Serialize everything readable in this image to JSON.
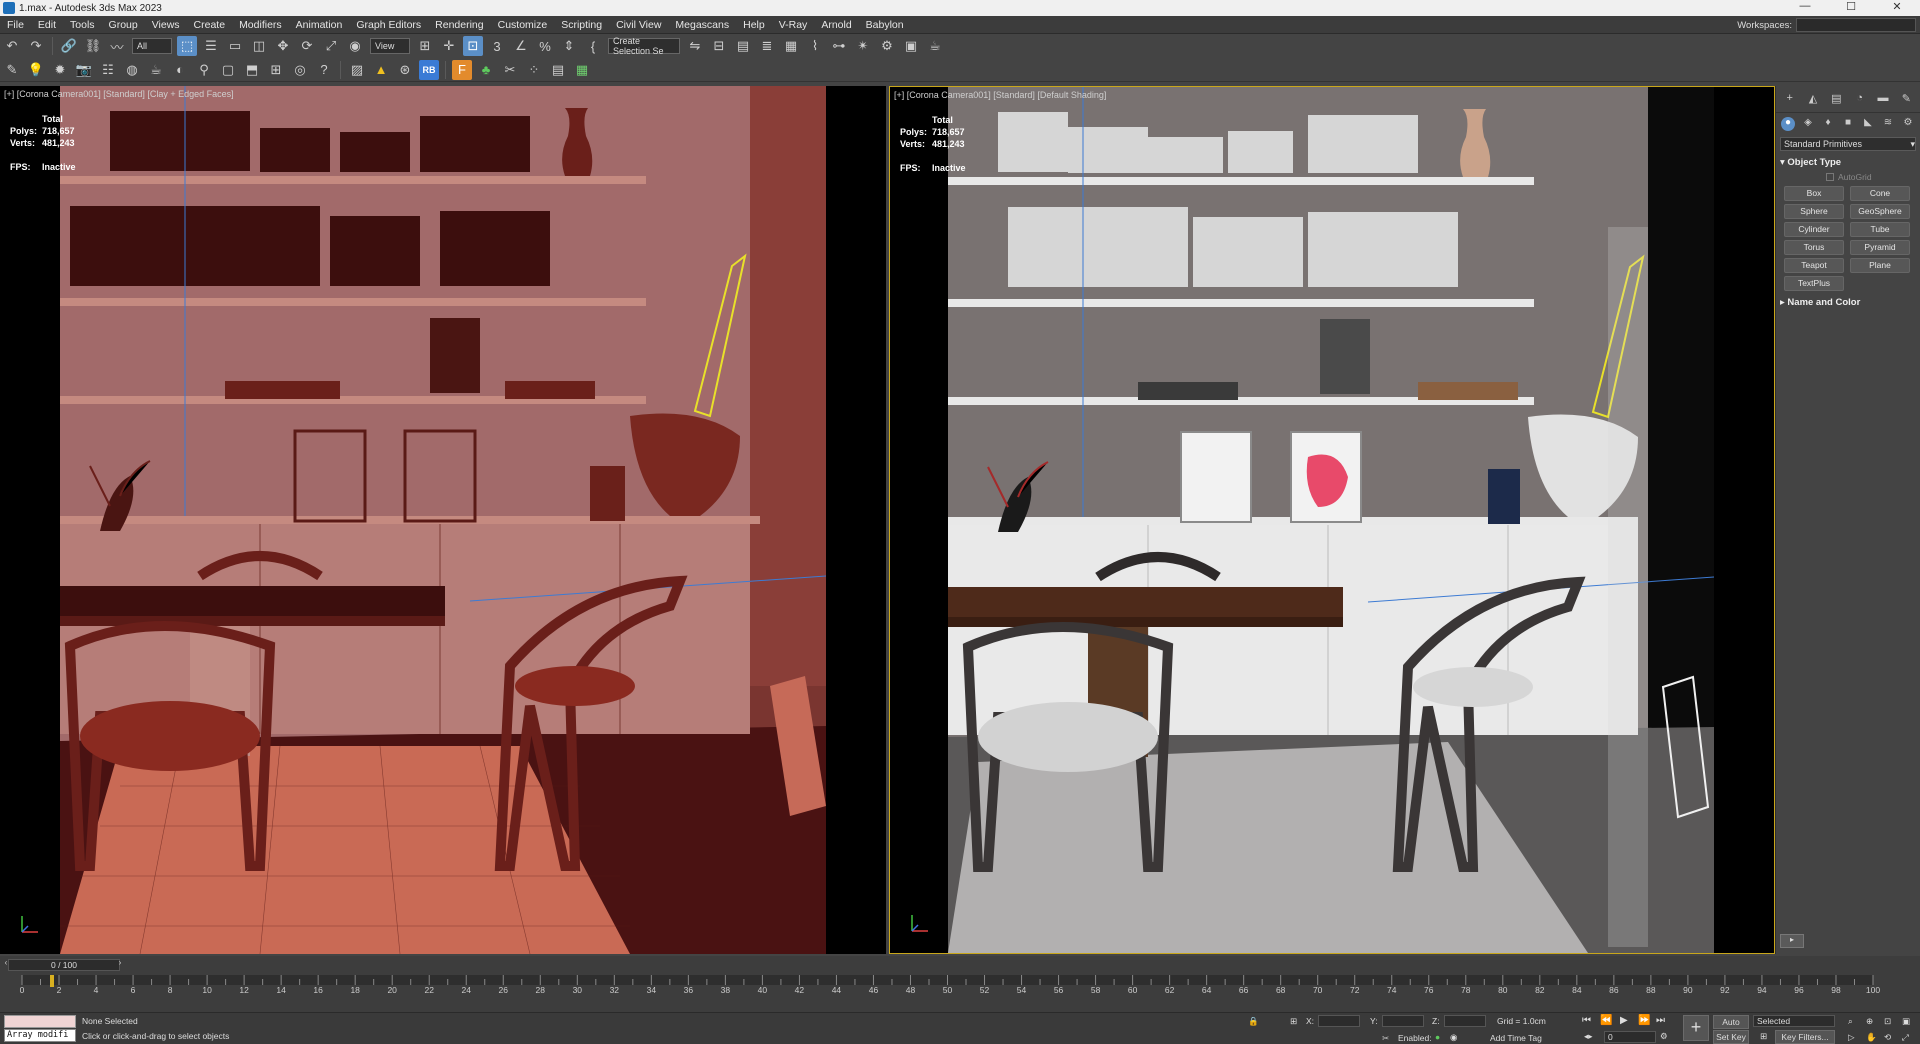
{
  "window": {
    "title": "1.max - Autodesk 3ds Max 2023",
    "minimize": "—",
    "maximize": "☐",
    "close": "✕"
  },
  "menu": [
    "File",
    "Edit",
    "Tools",
    "Group",
    "Views",
    "Create",
    "Modifiers",
    "Animation",
    "Graph Editors",
    "Rendering",
    "Customize",
    "Scripting",
    "Civil View",
    "Megascans",
    "Help",
    "V-Ray",
    "Arnold",
    "Babylon"
  ],
  "workspaces_label": "Workspaces:",
  "toolbar": {
    "selection_filter": "All",
    "ref_coord": "View",
    "named_selection": "Create Selection Se"
  },
  "viewport_left": {
    "label": "[+] [Corona Camera001] [Standard] [Clay + Edged Faces]",
    "stats": {
      "total": "Total",
      "polys_label": "Polys:",
      "polys": "718,657",
      "verts_label": "Verts:",
      "verts": "481,243",
      "fps_label": "FPS:",
      "fps": "Inactive"
    }
  },
  "viewport_right": {
    "label": "[+] [Corona Camera001] [Standard] [Default Shading]",
    "stats": {
      "total": "Total",
      "polys_label": "Polys:",
      "polys": "718,657",
      "verts_label": "Verts:",
      "verts": "481,243",
      "fps_label": "FPS:",
      "fps": "Inactive"
    }
  },
  "command_panel": {
    "category": "Standard Primitives",
    "object_type": "Object Type",
    "autogrid": "AutoGrid",
    "buttons": [
      "Box",
      "Cone",
      "Sphere",
      "GeoSphere",
      "Cylinder",
      "Tube",
      "Torus",
      "Pyramid",
      "Teapot",
      "Plane",
      "TextPlus"
    ],
    "name_and_color": "Name and Color"
  },
  "timeline": {
    "frame": "0 / 100",
    "ticks": [
      "0",
      "2",
      "4",
      "6",
      "8",
      "10",
      "12",
      "14",
      "16",
      "18",
      "20",
      "22",
      "24",
      "26",
      "28",
      "30",
      "32",
      "34",
      "36",
      "38",
      "40",
      "42",
      "44",
      "46",
      "48",
      "50",
      "52",
      "54",
      "56",
      "58",
      "60",
      "62",
      "64",
      "66",
      "68",
      "70",
      "72",
      "74",
      "76",
      "78",
      "80",
      "82",
      "84",
      "86",
      "88",
      "90",
      "92",
      "94",
      "96",
      "98",
      "100"
    ]
  },
  "status": {
    "maxscript": "Array modifi",
    "selection": "None Selected",
    "prompt": "Click or click-and-drag to select objects",
    "x_label": "X:",
    "y_label": "Y:",
    "z_label": "Z:",
    "grid": "Grid = 1.0cm",
    "enabled": "Enabled:",
    "add_time_tag": "Add Time Tag",
    "auto_key": "Auto Key",
    "set_key": "Set Key",
    "selected": "Selected",
    "key_filters": "Key Filters...",
    "current_frame": "0"
  }
}
